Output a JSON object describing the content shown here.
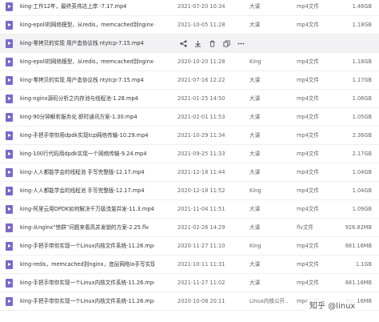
{
  "rows": [
    {
      "name": "king-工作12年，最终英伟达上岸 -7.17.mp4",
      "date": "2021-07-20 10:34",
      "owner": "大课",
      "type": "mp4文件",
      "size": "1.46GB"
    },
    {
      "name": "king-epoll的网络模型，从redis，memcached到nginx-...",
      "date": "2021-10-05 11:28",
      "owner": "大课",
      "type": "mp4文件",
      "size": "1.18GB"
    },
    {
      "name": "king-零拷贝的实现 用户态协议栈 ntytcp-7.15.mp4",
      "date": "",
      "owner": "",
      "type": "",
      "size": ""
    },
    {
      "name": "king-epoll的网络模型，从redis，memcached到nginx-...",
      "date": "2020-10-20 11:28",
      "owner": "King",
      "type": "mp4文件",
      "size": "1.18GB"
    },
    {
      "name": "king-零拷贝的实现 用户态协议栈 ntytcp-7.15.mp4",
      "date": "2021-07-16 12:22",
      "owner": "大课",
      "type": "mp4文件",
      "size": "1.17GB"
    },
    {
      "name": "king-nginx源码分析之内存池与线程池-1.28.mp4",
      "date": "2021-01-25 14:50",
      "owner": "大课",
      "type": "mp4文件",
      "size": "1.06GB"
    },
    {
      "name": "king-90分钟解析服务化 即时通讯方案-1.30.mp4",
      "date": "2021-02-01 11:53",
      "owner": "大课",
      "type": "mp4文件",
      "size": "1.05GB"
    },
    {
      "name": "king-手把手带你用dpdk实现tcp网络传输-10.29.mp4",
      "date": "2021-10-29 11:34",
      "owner": "大课",
      "type": "mp4文件",
      "size": "2.36GB"
    },
    {
      "name": "king-100行代码用dpdk实现一个网络传输-9.24.mp4",
      "date": "2021-09-25 11:33",
      "owner": "大课",
      "type": "mp4文件",
      "size": "2.17GB"
    },
    {
      "name": "king-人人都能学会的线程池 手写完整版-12.17.mp4",
      "date": "2021-12-18 11:44",
      "owner": "大课",
      "type": "mp4文件",
      "size": "1.04GB"
    },
    {
      "name": "king-人人都能学会的线程池 手写完整版-12.17.mp4",
      "date": "2020-12-18 11:52",
      "owner": "King",
      "type": "mp4文件",
      "size": "1.04GB"
    },
    {
      "name": "king-阿里云用DPDK如何解决千万级流量并发-11.3.mp4",
      "date": "2021-11-04 11:51",
      "owner": "大课",
      "type": "mp4文件",
      "size": "1.09GB"
    },
    {
      "name": "king-从nginx“惊群”问题来看高并发锁的方案-2.25.flv",
      "date": "2021-02-26 14:29",
      "owner": "大课",
      "type": "flv文件",
      "size": "926.82MB"
    },
    {
      "name": "king-手把手带你实现一个Linux内核文件系统-11.26.mp4",
      "date": "2020-11-27 11:10",
      "owner": "King",
      "type": "mp4文件",
      "size": "881.16MB"
    },
    {
      "name": "king-redis，memcached到nginx，底层网络io手写实现...",
      "date": "2021-10-11 11:31",
      "owner": "大课",
      "type": "mp4文件",
      "size": "1.1GB"
    },
    {
      "name": "king-手把手带你实现一个Linux内核文件系统-11.26.mp4",
      "date": "2021-11-27 11:02",
      "owner": "大课",
      "type": "mp4文件",
      "size": "881.16MB"
    },
    {
      "name": "king-手把手带你实现一个Linux内核文件系统-11.26.mp4",
      "date": "2020-10-08 20:11",
      "owner": "Linux内核公开...",
      "type": "mp4文件",
      "size": "881.16MB"
    }
  ],
  "watermark": "知乎 @linux",
  "colors": {
    "file_icon": "#7b68c8",
    "hover_row": "#f2f2f4"
  },
  "hover_actions": [
    "share-icon",
    "download-icon",
    "delete-icon",
    "copy-icon",
    "more-icon"
  ]
}
